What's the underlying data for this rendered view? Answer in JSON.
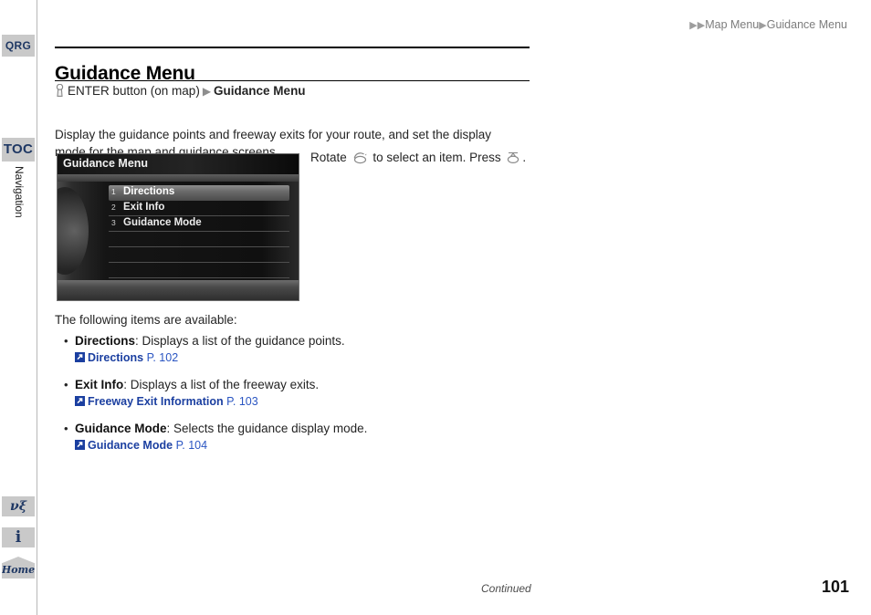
{
  "breadcrumb": {
    "arrow1": "▶",
    "arrow2": "▶",
    "section": "Map Menu",
    "separator": "▶",
    "page": "Guidance Menu"
  },
  "sidebar": {
    "tabs": [
      {
        "id": "qrg",
        "label": "QRG"
      },
      {
        "id": "toc",
        "label": "TOC"
      }
    ],
    "chapter_label": "Navigation",
    "icons": [
      {
        "id": "vsa",
        "name": "vsa-icon",
        "glyph": "νξ"
      },
      {
        "id": "info",
        "name": "info-icon",
        "glyph": "i"
      },
      {
        "id": "home",
        "name": "home-icon",
        "label": "Home"
      }
    ]
  },
  "header": {
    "title": "Guidance Menu"
  },
  "path": {
    "button_icon": "enter-button-icon",
    "button_text": "ENTER button (on map)",
    "arrow": "▶",
    "target": "Guidance Menu"
  },
  "intro": "Display the guidance points and freeway exits for your route, and set the display mode for the map and guidance screens.",
  "nav_screen": {
    "title": "Guidance Menu",
    "rows": [
      {
        "num": "1",
        "label": "Directions",
        "selected": true
      },
      {
        "num": "2",
        "label": "Exit Info",
        "selected": false
      },
      {
        "num": "3",
        "label": "Guidance Mode",
        "selected": false
      },
      {
        "num": "",
        "label": "",
        "selected": false
      },
      {
        "num": "",
        "label": "",
        "selected": false
      },
      {
        "num": "",
        "label": "",
        "selected": false
      }
    ]
  },
  "rotate_hint": {
    "part1": "Rotate",
    "dial_icon": "rotary-dial-icon",
    "part2": "to select an item. Press",
    "press_icon": "press-dial-icon",
    "part3": "."
  },
  "items": {
    "intro": "The following items are available:",
    "list": [
      {
        "bullet": "•",
        "name": "Directions",
        "description": ": Displays a list of the guidance points.",
        "ref_icon": "↗",
        "ref_title": "Directions",
        "ref_page": "P. 102"
      },
      {
        "bullet": "•",
        "name": "Exit Info",
        "description": ": Displays a list of the freeway exits.",
        "ref_icon": "↗",
        "ref_title": "Freeway Exit Information",
        "ref_page": "P. 103"
      },
      {
        "bullet": "•",
        "name": "Guidance Mode",
        "description": ": Selects the guidance display mode.",
        "ref_icon": "↗",
        "ref_title": "Guidance Mode",
        "ref_page": "P. 104"
      }
    ]
  },
  "footer": {
    "continued": "Continued",
    "page_number": "101"
  },
  "colors": {
    "tab_background": "#c9c9c9",
    "tab_text": "#1f3864",
    "link_blue": "#1b3fa0",
    "breadcrumb_gray": "#7d7d7d"
  }
}
